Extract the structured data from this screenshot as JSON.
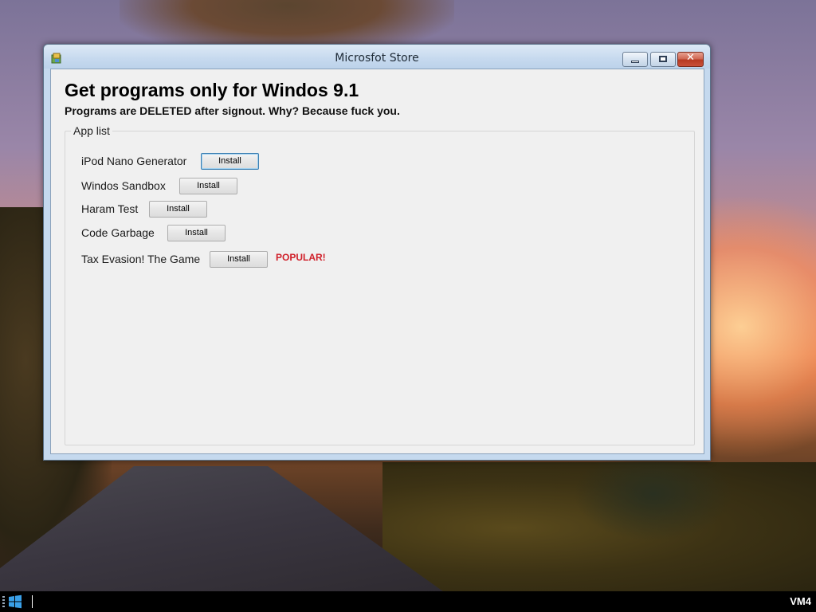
{
  "window": {
    "title": "Microsfot Store"
  },
  "content": {
    "heading": "Get programs only for Windos 9.1",
    "subheading": "Programs are DELETED after signout. Why? Because fuck you.",
    "group_label": "App list",
    "install_label": "Install",
    "apps": [
      {
        "name": "iPod Nano Generator"
      },
      {
        "name": "Windos Sandbox"
      },
      {
        "name": "Haram Test"
      },
      {
        "name": "Code Garbage"
      },
      {
        "name": "Tax Evasion! The Game",
        "badge": "POPULAR!"
      }
    ]
  },
  "taskbar": {
    "vm_label": "VM4"
  },
  "icons": {
    "window_icon": "app-window-icon",
    "start": "windows-logo-icon"
  },
  "colors": {
    "popular_badge": "#d0202a",
    "close_button": "#c9503a"
  }
}
